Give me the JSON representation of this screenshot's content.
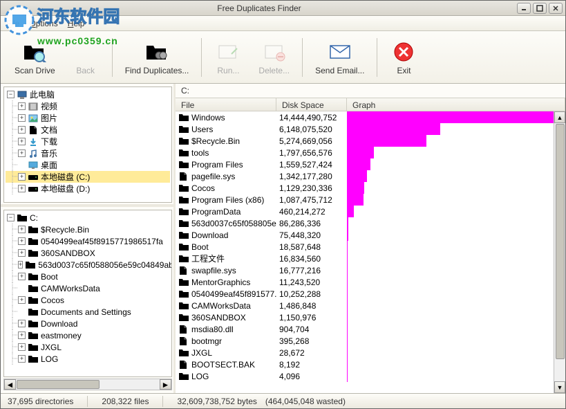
{
  "title": "Free Duplicates Finder",
  "watermark": {
    "text": "河东软件园",
    "url": "www.pc0359.cn"
  },
  "menu": {
    "file": "File",
    "options": "Options",
    "help": "Help"
  },
  "toolbar": {
    "scan": "Scan Drive",
    "back": "Back",
    "find": "Find Duplicates...",
    "run": "Run...",
    "delete": "Delete...",
    "email": "Send Email...",
    "exit": "Exit"
  },
  "tree_top": [
    {
      "label": "此电脑",
      "icon": "pc",
      "depth": 0,
      "expanded": true
    },
    {
      "label": "视频",
      "icon": "video",
      "depth": 1,
      "toggle": "+"
    },
    {
      "label": "图片",
      "icon": "image",
      "depth": 1,
      "toggle": "+"
    },
    {
      "label": "文档",
      "icon": "doc",
      "depth": 1,
      "toggle": "+"
    },
    {
      "label": "下载",
      "icon": "download",
      "depth": 1,
      "toggle": "+"
    },
    {
      "label": "音乐",
      "icon": "music",
      "depth": 1,
      "toggle": "+"
    },
    {
      "label": "桌面",
      "icon": "desktop",
      "depth": 1,
      "toggle": ""
    },
    {
      "label": "本地磁盘 (C:)",
      "icon": "drive",
      "depth": 1,
      "toggle": "+",
      "selected": true
    },
    {
      "label": "本地磁盘 (D:)",
      "icon": "drive",
      "depth": 1,
      "toggle": "+"
    }
  ],
  "tree_bottom": [
    {
      "label": "C:",
      "icon": "folder-open",
      "depth": 0,
      "expanded": true,
      "sel": true
    },
    {
      "label": "$Recycle.Bin",
      "icon": "folder",
      "depth": 1,
      "toggle": "+"
    },
    {
      "label": "0540499eaf45f8915771986517fa",
      "icon": "folder",
      "depth": 1,
      "toggle": "+"
    },
    {
      "label": "360SANDBOX",
      "icon": "folder",
      "depth": 1,
      "toggle": "+"
    },
    {
      "label": "563d0037c65f0588056e59c04849ab",
      "icon": "folder",
      "depth": 1,
      "toggle": "+"
    },
    {
      "label": "Boot",
      "icon": "folder",
      "depth": 1,
      "toggle": "+"
    },
    {
      "label": "CAMWorksData",
      "icon": "folder",
      "depth": 1,
      "toggle": ""
    },
    {
      "label": "Cocos",
      "icon": "folder",
      "depth": 1,
      "toggle": "+"
    },
    {
      "label": "Documents and Settings",
      "icon": "folder",
      "depth": 1,
      "toggle": ""
    },
    {
      "label": "Download",
      "icon": "folder",
      "depth": 1,
      "toggle": "+"
    },
    {
      "label": "eastmoney",
      "icon": "folder",
      "depth": 1,
      "toggle": "+"
    },
    {
      "label": "JXGL",
      "icon": "folder",
      "depth": 1,
      "toggle": "+"
    },
    {
      "label": "LOG",
      "icon": "folder",
      "depth": 1,
      "toggle": "+"
    }
  ],
  "path": "C:",
  "columns": {
    "file": "File",
    "size": "Disk Space",
    "graph": "Graph"
  },
  "chart_data": {
    "type": "bar",
    "title": "",
    "xlabel": "Disk Space (bytes)",
    "ylabel": "File",
    "categories": [
      "Windows",
      "Users",
      "$Recycle.Bin",
      "tools",
      "Program Files",
      "pagefile.sys",
      "Cocos",
      "Program Files (x86)",
      "ProgramData",
      "563d0037c65f058805e...",
      "Download",
      "Boot",
      "工程文件",
      "swapfile.sys",
      "MentorGraphics",
      "0540499eaf45f891577...",
      "CAMWorksData",
      "360SANDBOX",
      "msdia80.dll",
      "bootmgr",
      "JXGL",
      "BOOTSECT.BAK",
      "LOG"
    ],
    "values": [
      14444490752,
      6148075520,
      5274669056,
      1797656576,
      1559527424,
      1342177280,
      1129230336,
      1087475712,
      460214272,
      86286336,
      75448320,
      18587648,
      16834560,
      16777216,
      11243520,
      10252288,
      1486848,
      1150976,
      904704,
      395268,
      28672,
      8192,
      4096
    ]
  },
  "files": [
    {
      "name": "Windows",
      "size": "14,444,490,752",
      "bytes": 14444490752,
      "type": "folder"
    },
    {
      "name": "Users",
      "size": "6,148,075,520",
      "bytes": 6148075520,
      "type": "folder"
    },
    {
      "name": "$Recycle.Bin",
      "size": "5,274,669,056",
      "bytes": 5274669056,
      "type": "folder"
    },
    {
      "name": "tools",
      "size": "1,797,656,576",
      "bytes": 1797656576,
      "type": "folder"
    },
    {
      "name": "Program Files",
      "size": "1,559,527,424",
      "bytes": 1559527424,
      "type": "folder"
    },
    {
      "name": "pagefile.sys",
      "size": "1,342,177,280",
      "bytes": 1342177280,
      "type": "file"
    },
    {
      "name": "Cocos",
      "size": "1,129,230,336",
      "bytes": 1129230336,
      "type": "folder"
    },
    {
      "name": "Program Files (x86)",
      "size": "1,087,475,712",
      "bytes": 1087475712,
      "type": "folder"
    },
    {
      "name": "ProgramData",
      "size": "460,214,272",
      "bytes": 460214272,
      "type": "folder"
    },
    {
      "name": "563d0037c65f058805e...",
      "size": "86,286,336",
      "bytes": 86286336,
      "type": "folder"
    },
    {
      "name": "Download",
      "size": "75,448,320",
      "bytes": 75448320,
      "type": "folder"
    },
    {
      "name": "Boot",
      "size": "18,587,648",
      "bytes": 18587648,
      "type": "folder"
    },
    {
      "name": "工程文件",
      "size": "16,834,560",
      "bytes": 16834560,
      "type": "folder"
    },
    {
      "name": "swapfile.sys",
      "size": "16,777,216",
      "bytes": 16777216,
      "type": "file"
    },
    {
      "name": "MentorGraphics",
      "size": "11,243,520",
      "bytes": 11243520,
      "type": "folder"
    },
    {
      "name": "0540499eaf45f891577...",
      "size": "10,252,288",
      "bytes": 10252288,
      "type": "folder"
    },
    {
      "name": "CAMWorksData",
      "size": "1,486,848",
      "bytes": 1486848,
      "type": "folder"
    },
    {
      "name": "360SANDBOX",
      "size": "1,150,976",
      "bytes": 1150976,
      "type": "folder"
    },
    {
      "name": "msdia80.dll",
      "size": "904,704",
      "bytes": 904704,
      "type": "file"
    },
    {
      "name": "bootmgr",
      "size": "395,268",
      "bytes": 395268,
      "type": "file"
    },
    {
      "name": "JXGL",
      "size": "28,672",
      "bytes": 28672,
      "type": "folder"
    },
    {
      "name": "BOOTSECT.BAK",
      "size": "8,192",
      "bytes": 8192,
      "type": "file"
    },
    {
      "name": "LOG",
      "size": "4,096",
      "bytes": 4096,
      "type": "folder"
    }
  ],
  "status": {
    "dirs": "37,695 directories",
    "files": "208,322 files",
    "bytes": "32,609,738,752 bytes",
    "wasted": "(464,045,048 wasted)"
  }
}
